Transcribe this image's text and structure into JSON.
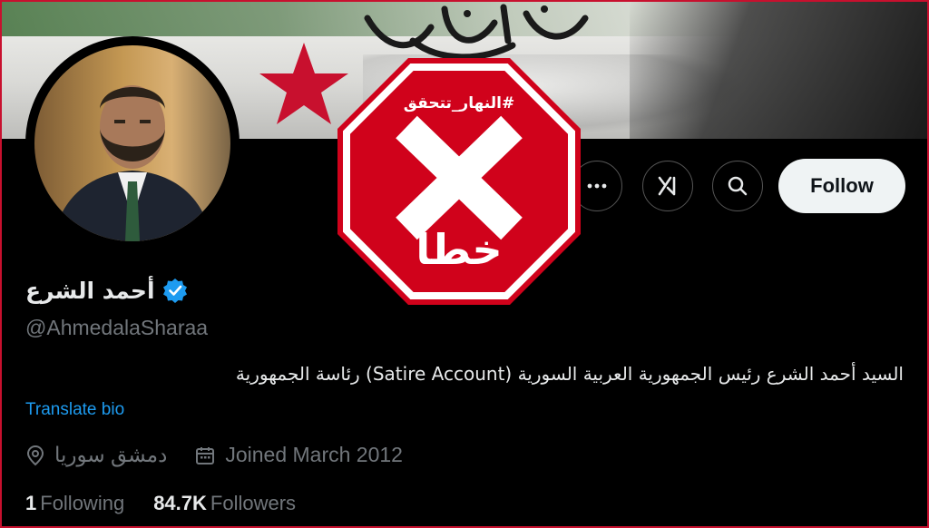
{
  "profile": {
    "display_name": "أحمد الشرع",
    "handle": "@AhmedalaSharaa",
    "bio": "السيد أحمد الشرع رئيس الجمهورية العربية السورية (Satire Account) رئاسة الجمهورية",
    "translate_label": "Translate bio",
    "location": "دمشق سوريا",
    "joined": "Joined March 2012",
    "following_count": "1",
    "following_label": "Following",
    "followers_count": "84.7K",
    "followers_label": "Followers",
    "verified": true
  },
  "actions": {
    "follow_label": "Follow",
    "icons": [
      "more-icon",
      "grok-icon",
      "search-icon"
    ]
  },
  "stamp": {
    "tag": "#النهار_تتحقق",
    "symbol": "X",
    "word": "خطأ"
  },
  "colors": {
    "background": "#000000",
    "text_primary": "#e7e9ea",
    "text_secondary": "#71767b",
    "link": "#1d9bf0",
    "verified": "#1d9bf0",
    "stamp_red": "#d0021b",
    "flag_green": "#3f6f3a",
    "flag_star": "#c8102e"
  }
}
